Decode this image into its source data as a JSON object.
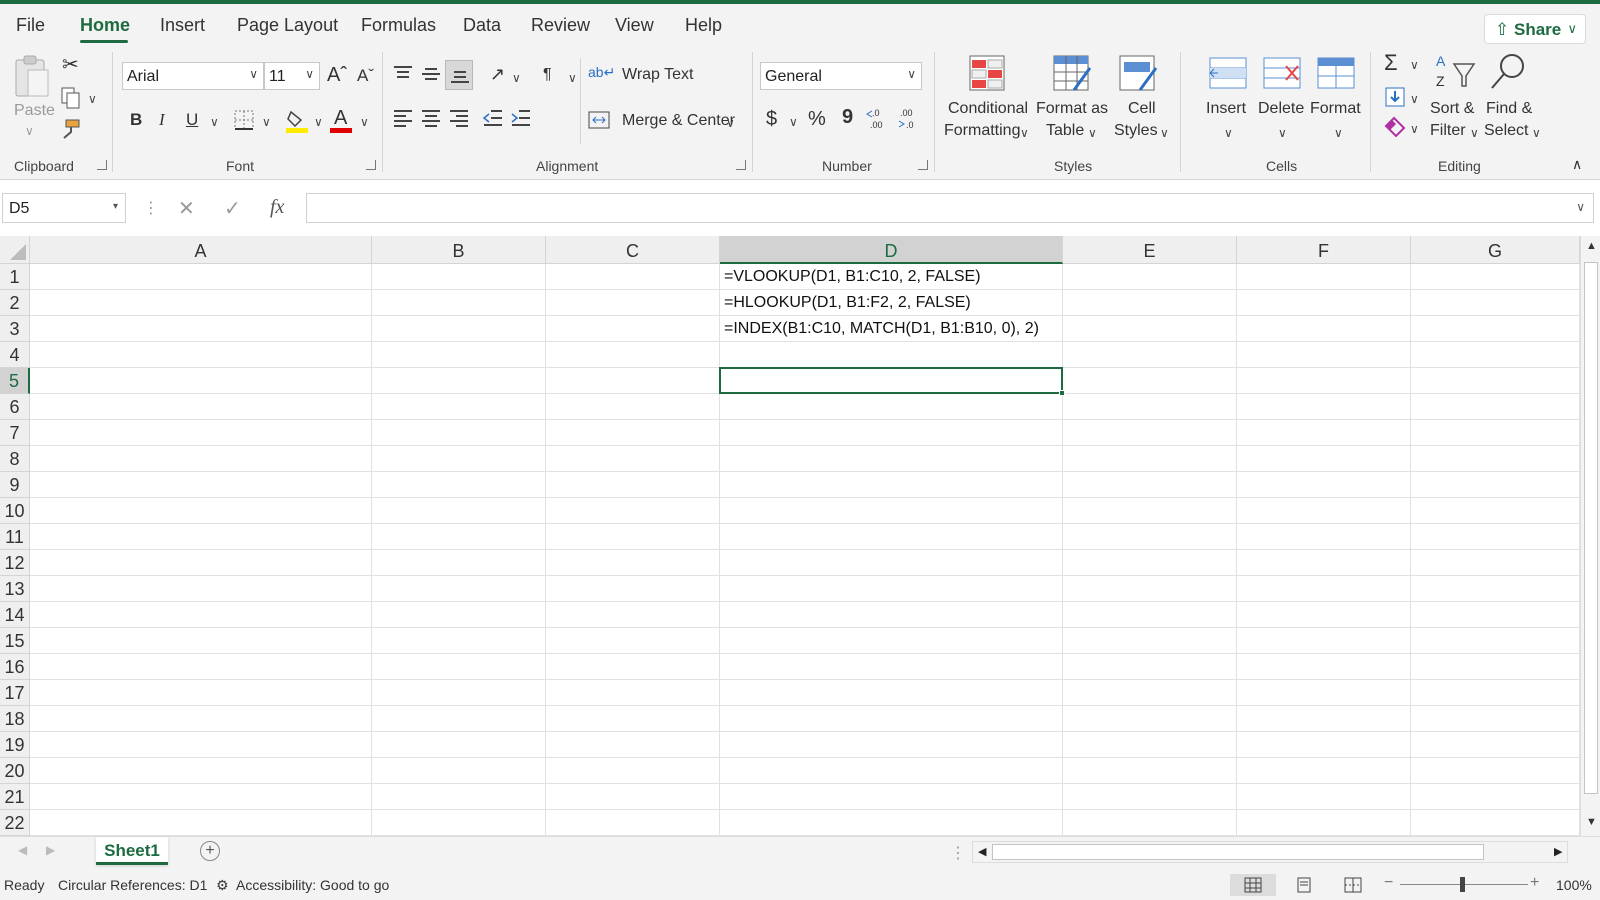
{
  "tabs": [
    "File",
    "Home",
    "Insert",
    "Page Layout",
    "Formulas",
    "Data",
    "Review",
    "View",
    "Help"
  ],
  "share_label": "Share",
  "clipboard": {
    "paste_label": "Paste",
    "group_label": "Clipboard"
  },
  "font": {
    "name": "Arial",
    "size": "11",
    "group_label": "Font",
    "bold": "B",
    "italic": "I",
    "underline": "U"
  },
  "alignment": {
    "wrap_text": "Wrap Text",
    "merge_center": "Merge & Center",
    "group_label": "Alignment"
  },
  "number": {
    "format": "General",
    "currency": "$",
    "percent": "%",
    "comma": "9",
    "group_label": "Number"
  },
  "styles": {
    "conditional_line1": "Conditional",
    "conditional_line2": "Formatting",
    "format_table_line1": "Format as",
    "format_table_line2": "Table",
    "cell_styles_line1": "Cell",
    "cell_styles_line2": "Styles",
    "group_label": "Styles"
  },
  "cells": {
    "insert": "Insert",
    "delete": "Delete",
    "format": "Format",
    "group_label": "Cells"
  },
  "editing": {
    "sort_line1": "Sort &",
    "sort_line2": "Filter",
    "find_line1": "Find &",
    "find_line2": "Select",
    "group_label": "Editing"
  },
  "formula_bar": {
    "name_box": "D5",
    "fx": "fx",
    "content": ""
  },
  "columns": [
    "A",
    "B",
    "C",
    "D",
    "E",
    "F",
    "G"
  ],
  "selected_column": "D",
  "rows": [
    "1",
    "2",
    "3",
    "4",
    "5",
    "6",
    "7",
    "8",
    "9",
    "10",
    "11",
    "12",
    "13",
    "14",
    "15",
    "16",
    "17",
    "18",
    "19",
    "20",
    "21",
    "22"
  ],
  "selected_row": "5",
  "cell_values": [
    {
      "ref": "D1",
      "value": "=VLOOKUP(D1, B1:C10, 2, FALSE)"
    },
    {
      "ref": "D2",
      "value": "=HLOOKUP(D1, B1:F2, 2, FALSE)"
    },
    {
      "ref": "D3",
      "value": "=INDEX(B1:C10, MATCH(D1, B1:B10, 0), 2)"
    }
  ],
  "sheet_tab": "Sheet1",
  "status": {
    "ready": "Ready",
    "circular": "Circular References: D1",
    "accessibility": "Accessibility: Good to go",
    "zoom": "100%"
  },
  "colors": {
    "accent": "#1e6b41",
    "ribbon_bg": "#f3f3f3"
  }
}
